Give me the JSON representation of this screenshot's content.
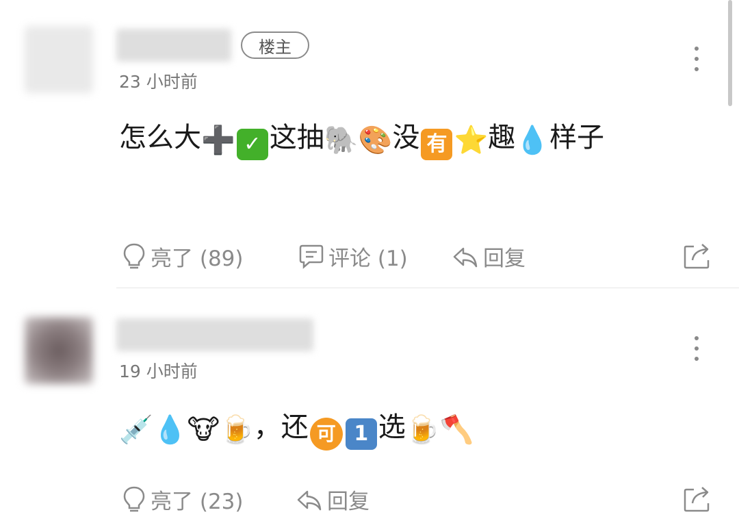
{
  "comments": [
    {
      "op_badge": "楼主",
      "time": "23 小时前",
      "content_parts": [
        {
          "t": "text",
          "v": "怎么大"
        },
        {
          "t": "emoji",
          "v": "➕",
          "name": "plus-emoji"
        },
        {
          "t": "box",
          "v": "✓",
          "name": "check-box-emoji",
          "style": "sq-check"
        },
        {
          "t": "text",
          "v": "这抽"
        },
        {
          "t": "emoji",
          "v": "🐘",
          "name": "elephant-emoji"
        },
        {
          "t": "emoji",
          "v": "🎨",
          "name": "palette-emoji"
        },
        {
          "t": "text",
          "v": "没"
        },
        {
          "t": "box",
          "v": "有",
          "name": "you-emoji",
          "style": "sq-orange"
        },
        {
          "t": "emoji",
          "v": "⭐",
          "name": "star-emoji"
        },
        {
          "t": "text",
          "v": "趣"
        },
        {
          "t": "emoji",
          "v": "💧",
          "name": "droplet-emoji"
        },
        {
          "t": "text",
          "v": "样子"
        }
      ],
      "actions": {
        "like": "亮了 (89)",
        "comment": "评论 (1)",
        "reply": "回复"
      }
    },
    {
      "time": "19 小时前",
      "content_parts": [
        {
          "t": "emoji",
          "v": "💉",
          "name": "syringe-emoji"
        },
        {
          "t": "emoji",
          "v": "💧",
          "name": "droplet-emoji"
        },
        {
          "t": "emoji",
          "v": "🐮",
          "name": "cow-face-emoji"
        },
        {
          "t": "emoji",
          "v": "🍺",
          "name": "beer-mug-emoji"
        },
        {
          "t": "text",
          "v": "，还"
        },
        {
          "t": "circle",
          "v": "可",
          "name": "ke-emoji"
        },
        {
          "t": "box",
          "v": "1",
          "name": "keycap-one-emoji",
          "style": "sq-blue"
        },
        {
          "t": "text",
          "v": "选"
        },
        {
          "t": "emoji",
          "v": "🍺",
          "name": "beer-mug-emoji"
        },
        {
          "t": "emoji",
          "v": "🪓",
          "name": "axe-emoji"
        }
      ],
      "actions": {
        "like": "亮了 (23)",
        "reply": "回复"
      }
    }
  ],
  "icons": {
    "more": "more-vertical-icon",
    "like": "lightbulb-icon",
    "comment": "comment-bubble-icon",
    "reply": "reply-arrow-icon",
    "share": "share-icon"
  },
  "colors": {
    "text": "#1a1a1a",
    "muted": "#8a8a8a",
    "check": "#43b02a",
    "orange": "#f59a23",
    "blue": "#4a86c8"
  }
}
